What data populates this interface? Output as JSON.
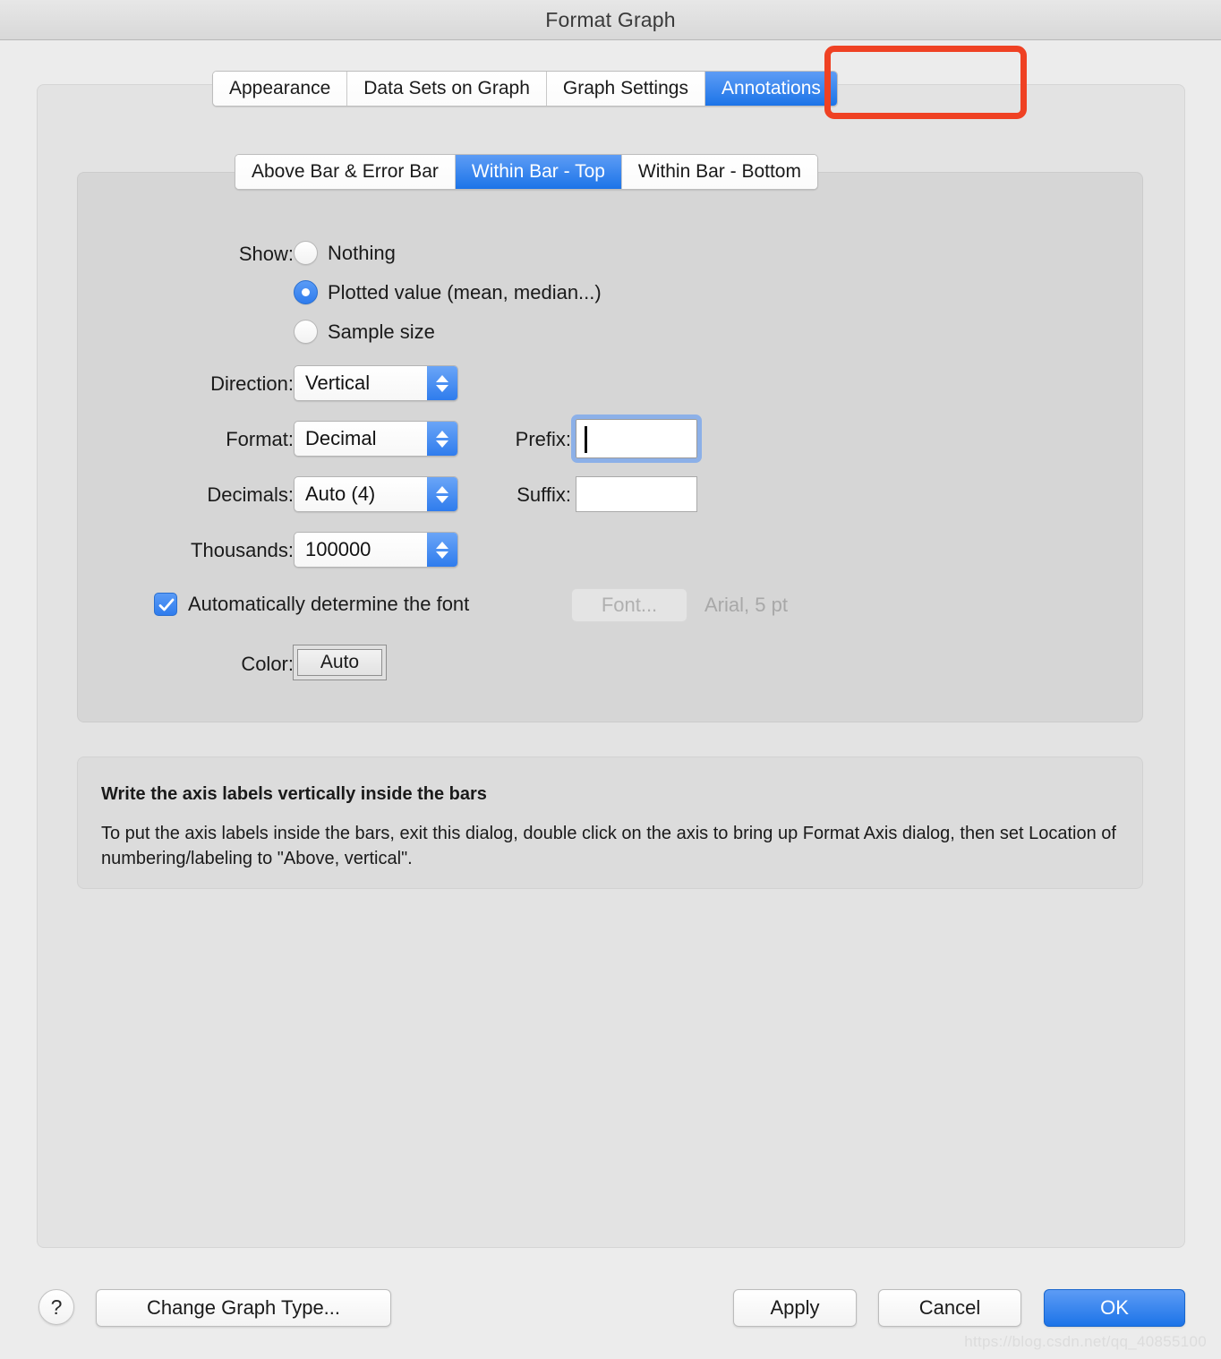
{
  "window": {
    "title": "Format Graph"
  },
  "tabs": [
    {
      "label": "Appearance",
      "active": false
    },
    {
      "label": "Data Sets on Graph",
      "active": false
    },
    {
      "label": "Graph Settings",
      "active": false
    },
    {
      "label": "Annotations",
      "active": true
    }
  ],
  "subtabs": [
    {
      "label": "Above Bar & Error Bar",
      "active": false
    },
    {
      "label": "Within Bar - Top",
      "active": true
    },
    {
      "label": "Within Bar - Bottom",
      "active": false
    }
  ],
  "annotation_highlight": {
    "target": "Annotations",
    "color": "#ef4123"
  },
  "form": {
    "show_label": "Show:",
    "show_options": [
      {
        "label": "Nothing",
        "selected": false
      },
      {
        "label": "Plotted value (mean, median...)",
        "selected": true
      },
      {
        "label": "Sample size",
        "selected": false
      }
    ],
    "direction_label": "Direction:",
    "direction_value": "Vertical",
    "format_label": "Format:",
    "format_value": "Decimal",
    "decimals_label": "Decimals:",
    "decimals_value": "Auto (4)",
    "thousands_label": "Thousands:",
    "thousands_value": "100000",
    "prefix_label": "Prefix:",
    "prefix_value": "",
    "suffix_label": "Suffix:",
    "suffix_value": "",
    "auto_font_label": "Automatically determine the font",
    "auto_font_checked": true,
    "font_button_label": "Font...",
    "font_description": "Arial, 5 pt",
    "color_label": "Color:",
    "color_value": "Auto"
  },
  "info": {
    "title": "Write the axis labels vertically inside the bars",
    "body": "To put the axis labels inside the bars, exit this dialog, double click on the axis to bring up Format Axis dialog, then set Location of numbering/labeling to \"Above, vertical\"."
  },
  "footer": {
    "help_label": "?",
    "change_graph_type_label": "Change Graph Type...",
    "apply_label": "Apply",
    "cancel_label": "Cancel",
    "ok_label": "OK"
  },
  "watermark": "https://blog.csdn.net/qq_40855100",
  "colors": {
    "accent": "#2f7ced",
    "highlight": "#ef4123",
    "window_bg": "#ececec",
    "panel_bg": "#e3e3e3",
    "inner_panel_bg": "#d6d6d6"
  }
}
